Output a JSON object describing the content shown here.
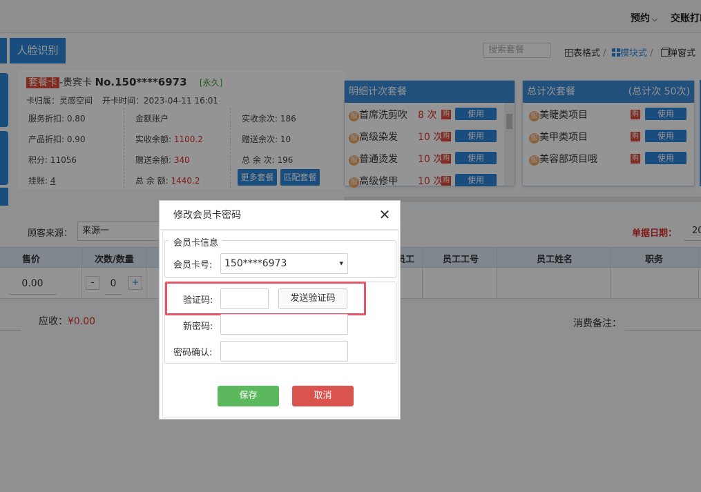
{
  "topbar": {
    "appointment": "预约",
    "handover": "交账打印"
  },
  "toolbar": {
    "face_recognition": "人脸识别",
    "search_placeholder": "搜索套餐",
    "view_table": "表格式",
    "view_module": "模块式",
    "view_popup": "弹窗式",
    "sep": "/"
  },
  "card": {
    "type_tag": "套餐卡",
    "level": "-贵宾卡",
    "number": "No.150****6973",
    "validity": "[永久]",
    "belongs_label": "卡归属：",
    "belongs_value": "灵感空间",
    "open_label": "开卡时间：",
    "open_value": "2023-04-11 16:01",
    "service_discount": "服务折扣: 0.80",
    "product_discount": "产品折扣: 0.90",
    "points": "积分: 11056",
    "credit_label": "挂账:",
    "credit_value": "4",
    "amount_account": "金额账户",
    "paid_balance_label": "实收余额:",
    "paid_balance_value": "1100.2",
    "gift_balance_label": "赠送余额:",
    "gift_balance_value": "340",
    "total_balance_label": "总 余 额:",
    "total_balance_value": "1440.2",
    "paid_times": "实收余次: 186",
    "gift_times": "赠送余次: 10",
    "total_times": "总 余 次: 196",
    "more_packages": "更多套餐",
    "match_packages": "匹配套餐"
  },
  "detail_panel": {
    "title": "明细计次套餐",
    "items": [
      {
        "icon": "服",
        "name": "首席洗剪吹",
        "times": "8 次",
        "buy": "购",
        "use": "使用"
      },
      {
        "icon": "服",
        "name": "高级染发",
        "times": "10 次",
        "buy": "购",
        "use": "使用"
      },
      {
        "icon": "服",
        "name": "普通烫发",
        "times": "10 次",
        "buy": "购",
        "use": "使用"
      },
      {
        "icon": "服",
        "name": "高级修甲",
        "times": "10 次",
        "buy": "购",
        "use": "使用"
      }
    ]
  },
  "total_panel": {
    "title": "总计次套餐",
    "total": "(总计次 50次)",
    "items": [
      {
        "icon": "服",
        "name": "美睫类项目",
        "buy": "购",
        "use": "使用"
      },
      {
        "icon": "服",
        "name": "美甲类项目",
        "buy": "购",
        "use": "使用"
      },
      {
        "icon": "服",
        "name": "美容部项目哦",
        "buy": "购",
        "use": "使用"
      }
    ]
  },
  "order": {
    "source_label": "顾客来源：",
    "source_value": "来源一",
    "date_label": "单据日期：",
    "date_value": "20"
  },
  "table": {
    "headers": {
      "price": "售价",
      "qty": "次数/数量",
      "staff_partial": "员工",
      "staff_no": "员工工号",
      "staff_name": "员工姓名",
      "position": "职务"
    },
    "row": {
      "price": "0.00",
      "minus": "-",
      "qty": "0",
      "plus": "+"
    }
  },
  "summary": {
    "receivable_label": "应收：",
    "receivable_value": "¥0.00",
    "remark_label": "消费备注："
  },
  "dialog": {
    "title": "修改会员卡密码",
    "legend": "会员卡信息",
    "card_no_label": "会员卡号:",
    "card_no_value": "150****6973",
    "code_label": "验证码:",
    "send_code": "发送验证码",
    "new_pwd_label": "新密码:",
    "confirm_label": "密码确认:",
    "save": "保存",
    "cancel": "取消"
  },
  "colors": {
    "accent": "#2a86d9",
    "danger": "#e04a3a",
    "highlight_box": "#e8536a"
  }
}
